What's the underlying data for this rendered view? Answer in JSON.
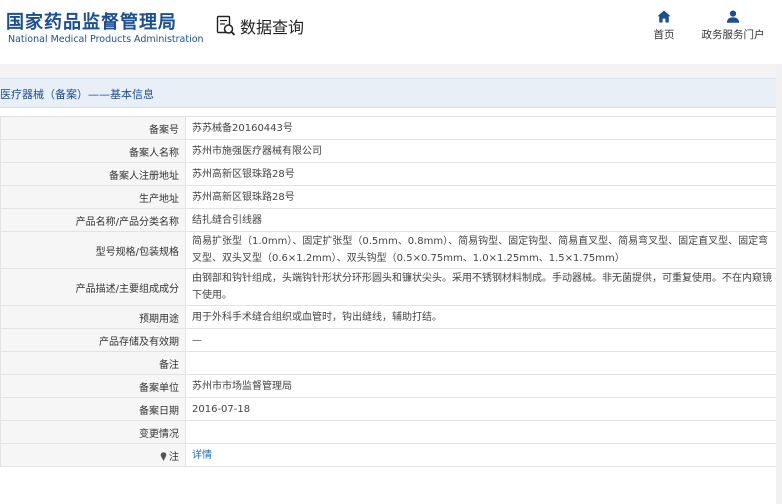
{
  "header": {
    "logo_cn": "国家药品监督管理局",
    "logo_en": "National Medical Products Administration",
    "query_label": "数据查询",
    "nav": {
      "home": "首页",
      "gov": "政务服务门户"
    }
  },
  "breadcrumb": "医疗器械（备案）——基本信息",
  "rows": [
    {
      "label": "备案号",
      "value": "苏苏械备20160443号"
    },
    {
      "label": "备案人名称",
      "value": "苏州市施强医疗器械有限公司"
    },
    {
      "label": "备案人注册地址",
      "value": "苏州高新区银珠路28号"
    },
    {
      "label": "生产地址",
      "value": "苏州高新区银珠路28号"
    },
    {
      "label": "产品名称/产品分类名称",
      "value": "结扎缝合引线器"
    },
    {
      "label": "型号规格/包装规格",
      "value": "简易扩张型（1.0mm）、固定扩张型（0.5mm、0.8mm）、简易钩型、固定钩型、简易直叉型、简易弯叉型、固定直叉型、固定弯叉型、双头叉型（0.6×1.2mm）、双头钩型（0.5×0.75mm、1.0×1.25mm、1.5×1.75mm）"
    },
    {
      "label": "产品描述/主要组成成分",
      "value": "由钢部和钩针组成，头端钩针形状分环形圆头和镰状尖头。采用不锈钢材料制成。手动器械。非无菌提供，可重复使用。不在内窥镜下使用。"
    },
    {
      "label": "预期用途",
      "value": "用于外科手术缝合组织或血管时，钩出缝线，辅助打结。"
    },
    {
      "label": "产品存储及有效期",
      "value": "—"
    },
    {
      "label": "备注",
      "value": ""
    },
    {
      "label": "备案单位",
      "value": "苏州市市场监督管理局"
    },
    {
      "label": "备案日期",
      "value": "2016-07-18"
    },
    {
      "label": "变更情况",
      "value": ""
    },
    {
      "label": "注",
      "value": "详情"
    }
  ],
  "colors": {
    "brand": "#1b4f93",
    "link": "#1b6fc2",
    "crumb_bg": "#e8eff7"
  },
  "icons": {
    "query": "search-document-icon",
    "home": "home-icon",
    "gov": "user-icon",
    "note": "pin-icon"
  }
}
